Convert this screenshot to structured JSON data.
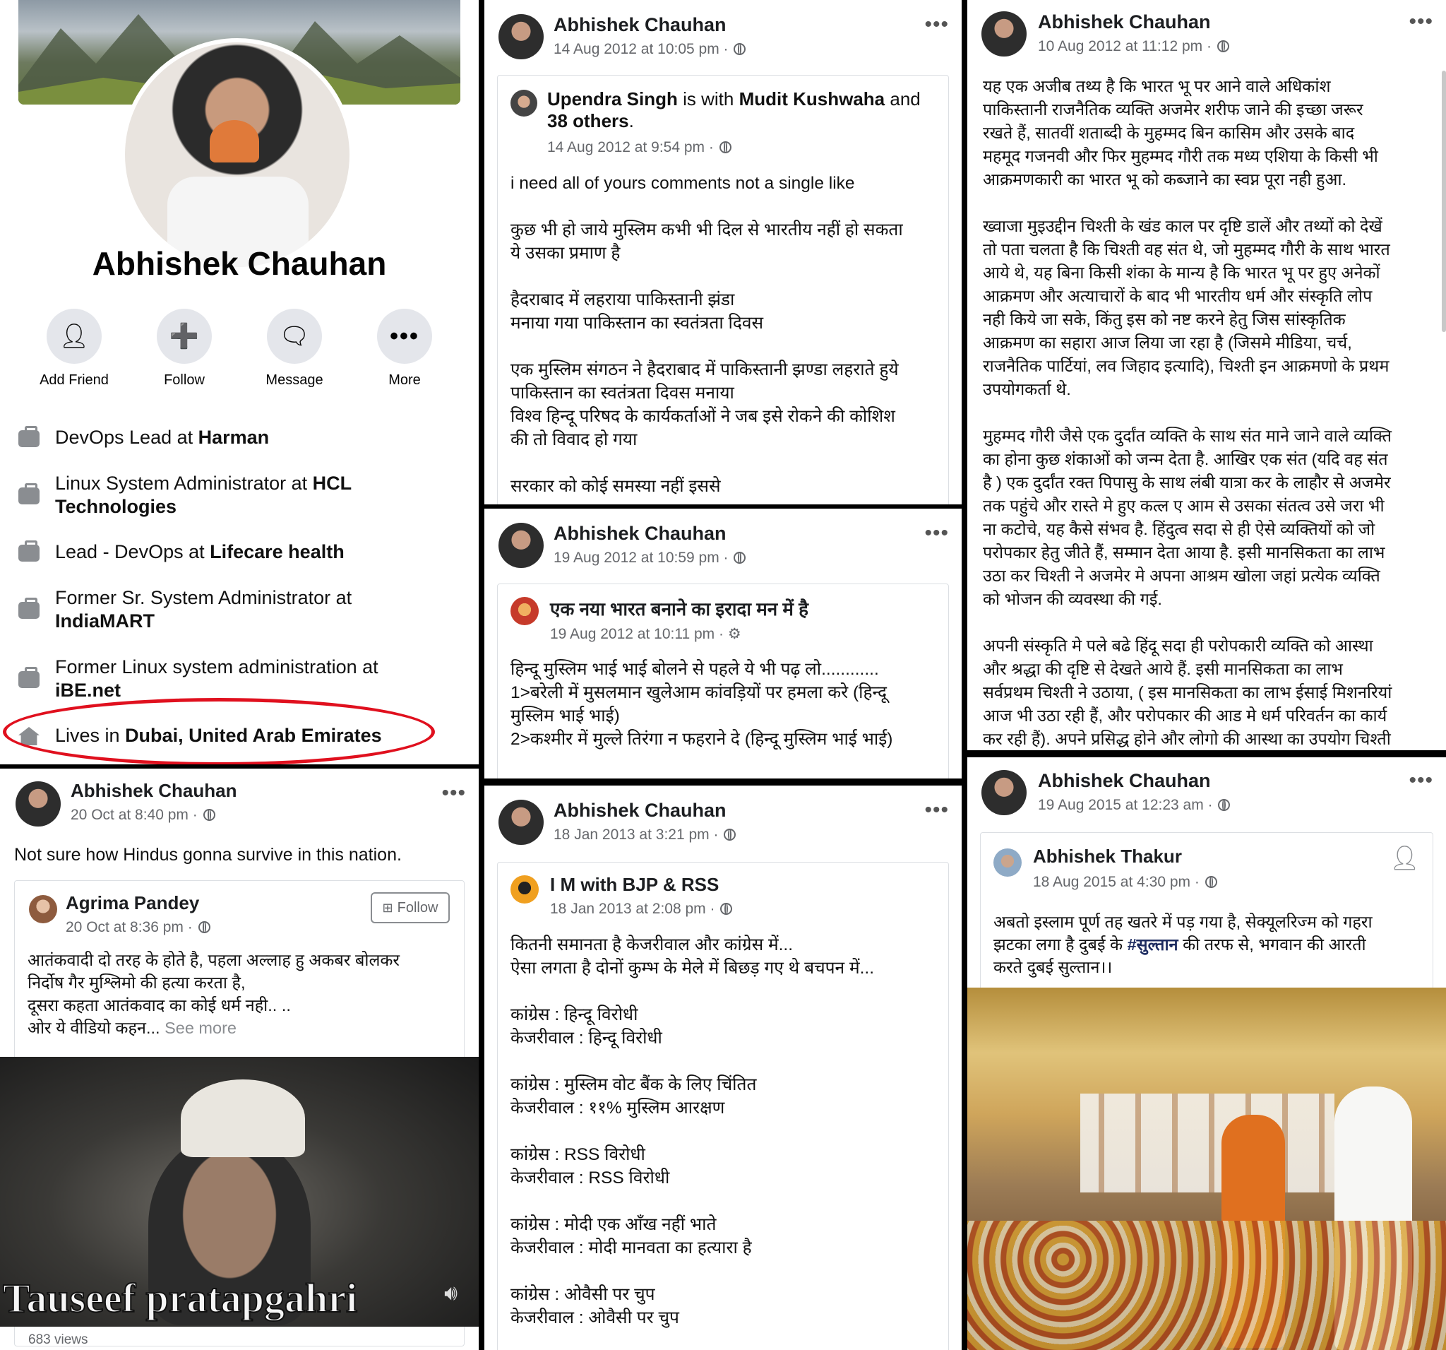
{
  "profile": {
    "name": "Abhishek Chauhan",
    "actions": [
      {
        "label": "Add Friend",
        "icon": "add-friend-icon"
      },
      {
        "label": "Follow",
        "icon": "follow-icon"
      },
      {
        "label": "Message",
        "icon": "messenger-icon"
      },
      {
        "label": "More",
        "icon": "more-icon"
      }
    ],
    "work": [
      {
        "pre": "DevOps Lead at ",
        "bold": "Harman"
      },
      {
        "pre": "Linux System Administrator at ",
        "bold": "HCL Technologies"
      },
      {
        "pre": "Lead - DevOps at ",
        "bold": "Lifecare health"
      },
      {
        "pre": "Former Sr. System Administrator at ",
        "bold": "IndiaMART"
      },
      {
        "pre": "Former Linux system administration at ",
        "bold": "iBE.net"
      }
    ],
    "lives": {
      "pre": "Lives in ",
      "bold": "Dubai, United Arab Emirates"
    },
    "highlight_color": "#e0101e"
  },
  "post_bl": {
    "author": "Abhishek Chauhan",
    "time": "20 Oct at 8:40 pm ·",
    "text": "Not sure how Hindus gonna survive in this nation.",
    "shared_author": "Agrima Pandey",
    "shared_time": "20 Oct at 8:36 pm ·",
    "follow": "Follow",
    "shared_text": "आतंकवादी दो तरह के होते है, पहला अल्लाह हु अकबर बोलकर\nनिर्दोष गैर मुश्लिमो की हत्या करता है,\nदूसरा कहता आतंकवाद का कोई धर्म नही.. ..\nओर ये वीडियो कहन...",
    "see_more": "See more",
    "video_caption": "Tauseef pratapgahri",
    "views": "683 views"
  },
  "post_m1": {
    "author": "Abhishek Chauhan",
    "time": "14 Aug 2012 at 10:05 pm ·",
    "sharer": "Upendra Singh",
    "with": " is with ",
    "tagged": "Mudit Kushwaha",
    "and": " and ",
    "others": "38 others",
    "shared_time": "14 Aug 2012 at 9:54 pm ·",
    "text": "i need all of yours comments not a single like\n\nकुछ भी हो जाये मुस्लिम कभी भी दिल से भारतीय नहीं हो सकता\nये उसका प्रमाण है\n\nहैदराबाद में लहराया पाकिस्तानी झंडा\nमनाया गया पाकिस्तान का स्वतंत्रता दिवस\n\nएक मुस्लिम संगठन ने हैदराबाद में पाकिस्तानी झण्डा लहराते हुये\nपाकिस्तान का स्वतंत्रता दिवस मनाया\nविश्व हिन्दू परिषद के कार्यकर्ताओं ने जब इसे रोकने की कोशिश\nकी तो विवाद हो गया\n\nसरकार को कोई समस्या नहीं इससे"
  },
  "post_m2": {
    "author": "Abhishek Chauhan",
    "time": "19 Aug 2012 at 10:59 pm ·",
    "shared_author": "एक नया भारत बनाने का इरादा मन में है",
    "shared_time": "19 Aug 2012 at 10:11 pm ·",
    "text": "हिन्दू मुस्लिम भाई भाई बोलने से पहले ये भी पढ़ लो............\n1>बरेली में मुसलमान खुलेआम कांवड़ियों पर हमला करे (हिन्दू\nमुस्लिम भाई भाई)\n2>कश्मीर में मुल्ले तिरंगा न फहराने दे (हिन्दू मुस्लिम भाई भाई)"
  },
  "post_m3": {
    "author": "Abhishek Chauhan",
    "time": "18 Jan 2013 at 3:21 pm ·",
    "shared_author": "I M with BJP & RSS",
    "shared_time": "18 Jan 2013 at 2:08 pm ·",
    "text": "कितनी समानता है केजरीवाल और कांग्रेस में...\nऐसा लगता है दोनों कुम्भ के मेले में बिछड़ गए थे बचपन में...\n\nकांग्रेस : हिन्दू विरोधी\nकेजरीवाल : हिन्दू विरोधी\n\nकांग्रेस : मुस्लिम वोट बैंक के लिए चिंतित\nकेजरीवाल : ११% मुस्लिम आरक्षण\n\nकांग्रेस : RSS विरोधी\nकेजरीवाल : RSS विरोधी\n\nकांग्रेस : मोदी एक आँख नहीं भाते\nकेजरीवाल : मोदी मानवता का हत्यारा है\n\nकांग्रेस : ओवैसी पर चुप\nकेजरीवाल : ओवैसी पर चुप"
  },
  "post_r1": {
    "author": "Abhishek Chauhan",
    "time": "10 Aug 2012 at 11:12 pm ·",
    "text": "यह एक अजीब तथ्य है कि भारत भू पर आने वाले अधिकांश\nपाकिस्तानी राजनैतिक व्यक्ति अजमेर शरीफ जाने की इच्छा जरूर\nरखते हैं, सातवीं शताब्दी के मुहम्मद बिन कासिम और उसके बाद\nमहमूद गजनवी और फिर मुहम्मद गौरी तक मध्य एशिया के किसी भी\nआक्रमणकारी का भारत भू को कब्जाने का स्वप्न पूरा नही हुआ.\n\nख्वाजा मुइउद्दीन चिश्ती के खंड काल पर दृष्टि डालें और तथ्यों को देखें\nतो पता चलता है कि चिश्ती वह संत थे, जो मुहम्मद गौरी के साथ भारत\nआये थे,  यह बिना किसी शंका के मान्य है कि भारत भू पर हुए अनेकों\nआक्रमण और अत्याचारों के बाद भी भारतीय धर्म और संस्कृति लोप\nनही किये जा सके, किंतु इस को नष्ट करने हेतु जिस सांस्कृतिक\nआक्रमण का सहारा आज लिया जा रहा है (जिसमे मीडिया, चर्च,\nराजनैतिक पार्टियां, लव जिहाद इत्यादि), चिश्ती इन आक्रमणो के प्रथम\nउपयोगकर्ता थे.\n\nमुहम्मद गौरी जैसे एक दुर्दांत व्यक्ति  के साथ संत माने जाने वाले व्यक्ति\nका होना कुछ शंकाओं को जन्म देता है. आखिर एक संत (यदि वह संत\nहै ) एक दुर्दांत रक्त पिपासु के साथ लंबी यात्रा कर के लाहौर से अजमेर\nतक पहुंचे और रास्ते मे हुए कत्ल ए आम से उसका संतत्व उसे जरा भी\nना कटोचे, यह कैसे संभव है. हिंदुत्व सदा से ही ऐसे व्यक्तियों को जो\nपरोपकार हेतु जीते हैं, सम्मान देता आया है. इसी मानसिकता का लाभ\nउठा कर चिश्ती ने अजमेर मे अपना आश्रम खोला जहां प्रत्येक व्यक्ति\nको भोजन की व्यवस्था की गई.\n\nअपनी संस्कृति मे पले बढे हिंदू सदा ही परोपकारी व्यक्ति को आस्था\nऔर श्रद्धा की दृष्टि से देखते आये हैं. इसी मानसिकता का लाभ\nसर्वप्रथम चिश्ती ने उठाया, ( इस मानसिकता का लाभ ईसाई मिशनरियां\nआज भी उठा रही हैं, और परोपकार की आड मे धर्म परिवर्तन का कार्य\nकर रही हैं). अपने प्रसिद्ध होने और लोगो की आस्था का उपयोग चिश्ती"
  },
  "post_r2": {
    "author": "Abhishek Chauhan",
    "time": "19 Aug 2015 at 12:23 am ·",
    "shared_author": "Abhishek Thakur",
    "shared_time": "18 Aug 2015 at 4:30 pm ·",
    "text_a": "अबतो इस्लाम पूर्ण तह खतरे में पड़ गया है, सेक्यूलरिज्म को गहरा\nझटका लगा है दुबई के ",
    "hashtag": "#सुल्तान",
    "text_b": " की तरफ से, भगवान की आरती\nकरते दुबई सुल्तान।।"
  }
}
